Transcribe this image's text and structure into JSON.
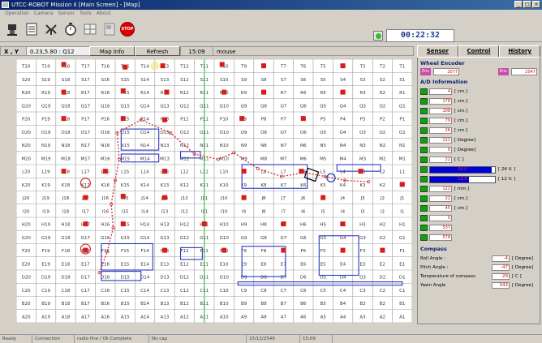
{
  "window": {
    "title": "UTCC-ROBOT Mission II [Main Screen] - [Map]"
  },
  "menu": [
    "Operation",
    "Camera",
    "Sensor",
    "Tools",
    "About"
  ],
  "clock": "00:22:32",
  "info": {
    "label": "X , Y",
    "coord": "0.23,5.80 : Q12",
    "map_info": "Map Info",
    "refresh": "Refresh",
    "time": "15:09",
    "mode": "mouse"
  },
  "tabs": [
    "Sensor",
    "Control",
    "History"
  ],
  "sensor": {
    "wheel_title": "Wheel Encoder",
    "enc": [
      {
        "label": "Enc",
        "value": "2077"
      },
      {
        "label": "Enc",
        "value": "2047"
      }
    ],
    "ad_title": "A/D Information",
    "ad": [
      {
        "v": "4",
        "unit": "[ cm.]"
      },
      {
        "v": "178",
        "unit": "[ cm.]"
      },
      {
        "v": "108",
        "unit": "[ cm.]"
      },
      {
        "v": "79",
        "unit": "[ cm.]"
      },
      {
        "v": "26",
        "unit": "[ cm.]"
      },
      {
        "v": "121",
        "unit": "[ Degree]"
      },
      {
        "v": "0",
        "unit": "[ Degree]"
      },
      {
        "v": "22",
        "unit": "[ C ]"
      },
      {
        "bar": "24.0",
        "fill": 0.95,
        "unit": "[ 24 V. ]"
      },
      {
        "bar": "12.0",
        "fill": 0.6,
        "unit": "[ 12 V. ]"
      },
      {
        "v": "122",
        "unit": "[ mm.]"
      },
      {
        "v": "22",
        "unit": "[ cm.]"
      },
      {
        "v": "45",
        "unit": "[ cm.]"
      },
      {
        "v": "0",
        "unit": ""
      },
      {
        "v": "537",
        "unit": ""
      },
      {
        "v": "578",
        "unit": ""
      }
    ],
    "compass_title": "Compass",
    "compass": [
      {
        "label": "Roll Angle :",
        "v": "-4",
        "unit": "[ Degree]"
      },
      {
        "label": "Pitch Angle :",
        "v": "-47",
        "unit": "[ Degree]"
      },
      {
        "label": "Temperature of compass",
        "v": "29",
        "unit": "[ C ]"
      },
      {
        "label": "Yawn Angle",
        "v": "343",
        "unit": "[ Degree]"
      }
    ]
  },
  "map": {
    "cols": [
      "20",
      "19",
      "18",
      "17",
      "16",
      "15",
      "14",
      "13",
      "12",
      "11",
      "10",
      "9",
      "8",
      "7",
      "6",
      "5",
      "4",
      "3",
      "2",
      "1"
    ],
    "rows": [
      "T",
      "S",
      "R",
      "Q",
      "P",
      "O",
      "N",
      "M",
      "L",
      "K",
      "J",
      "I",
      "H",
      "G",
      "F",
      "E",
      "D",
      "C",
      "B",
      "A"
    ],
    "colors": {
      "grid": "#9a9a9a",
      "label": "#333333",
      "wall": "#2a36c4",
      "marker": "#d71c1c",
      "path": "#d13030",
      "green": "#37c837"
    }
  },
  "status": [
    "Ready",
    "Connection",
    "radio fine / Ok Complete",
    "No cap",
    "15/12/2549",
    "15:09"
  ]
}
